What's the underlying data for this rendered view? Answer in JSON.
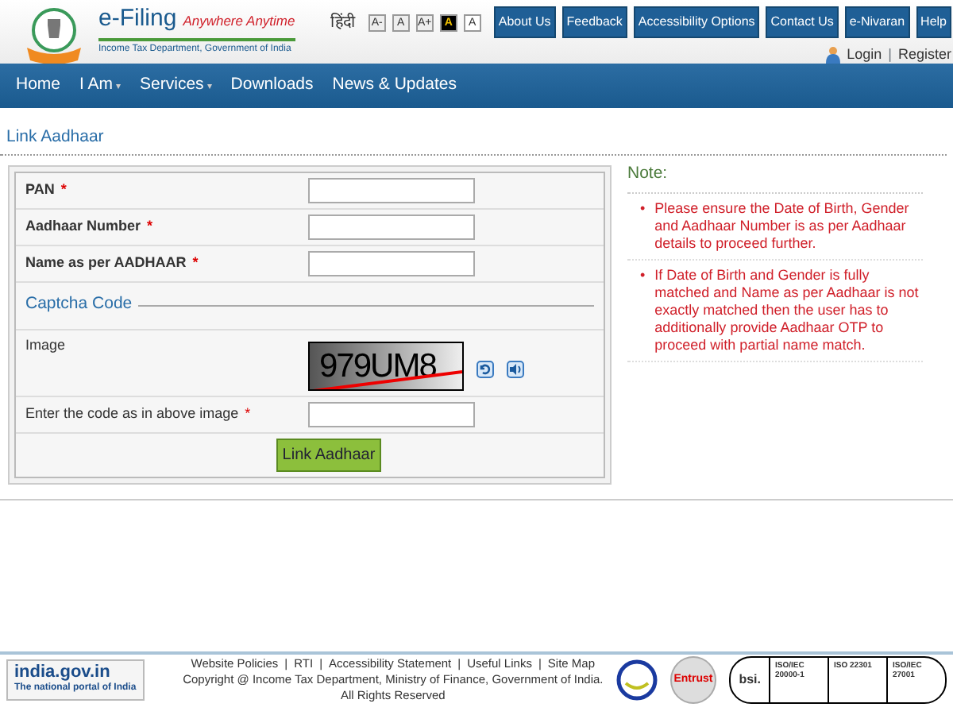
{
  "header": {
    "brand": "e-Filing",
    "tagline": "Anywhere Anytime",
    "department": "Income Tax Department, Government of India",
    "language": "हिंदी",
    "font_buttons": [
      {
        "label": "A-",
        "kind": "plain"
      },
      {
        "label": "A",
        "kind": "plain"
      },
      {
        "label": "A+",
        "kind": "plain"
      },
      {
        "label": "A",
        "kind": "contrast"
      },
      {
        "label": "A",
        "kind": "white"
      }
    ],
    "top_links": [
      "About Us",
      "Feedback",
      "Accessibility Options",
      "Contact Us",
      "e-Nivaran",
      "Help"
    ],
    "login": "Login",
    "separator": "|",
    "register": "Register"
  },
  "nav": [
    {
      "label": "Home"
    },
    {
      "label": "I Am",
      "caret": "▾"
    },
    {
      "label": "Services",
      "caret": "▾"
    },
    {
      "label": "Downloads"
    },
    {
      "label": "News & Updates"
    }
  ],
  "page_title": "Link Aadhaar",
  "form": {
    "fields": [
      {
        "label": "PAN",
        "required_mark": "*"
      },
      {
        "label": "Aadhaar Number",
        "required_mark": "*"
      },
      {
        "label": "Name as per AADHAAR",
        "required_mark": "*"
      }
    ],
    "captcha_heading": "Captcha Code",
    "image_label": "Image",
    "captcha_text": "979UM8",
    "code_field": {
      "label": "Enter the code as in above image",
      "required_mark": "*"
    },
    "submit": "Link Aadhaar"
  },
  "note": {
    "title": "Note:",
    "bullet": "•",
    "items": [
      "Please ensure the Date of Birth, Gender and Aadhaar Number is as per Aadhaar details to proceed further.",
      "If Date of Birth and Gender is fully matched and Name as per Aadhaar is not exactly matched then the user has to additionally provide Aadhaar OTP to proceed with partial name match."
    ]
  },
  "footer": {
    "portal": "india.gov.in",
    "portal_tagline": "The national portal of India",
    "links": [
      "Website Policies",
      "RTI",
      "Accessibility Statement",
      "Useful Links",
      "Site Map"
    ],
    "separator": "|",
    "copyright": "Copyright @ Income Tax Department, Ministry of Finance, Government of India. All Rights Reserved",
    "entrust": "Entrust",
    "bsi": "bsi.",
    "iso": [
      "ISO/IEC 20000-1",
      "ISO 22301",
      "ISO/IEC 27001"
    ]
  }
}
